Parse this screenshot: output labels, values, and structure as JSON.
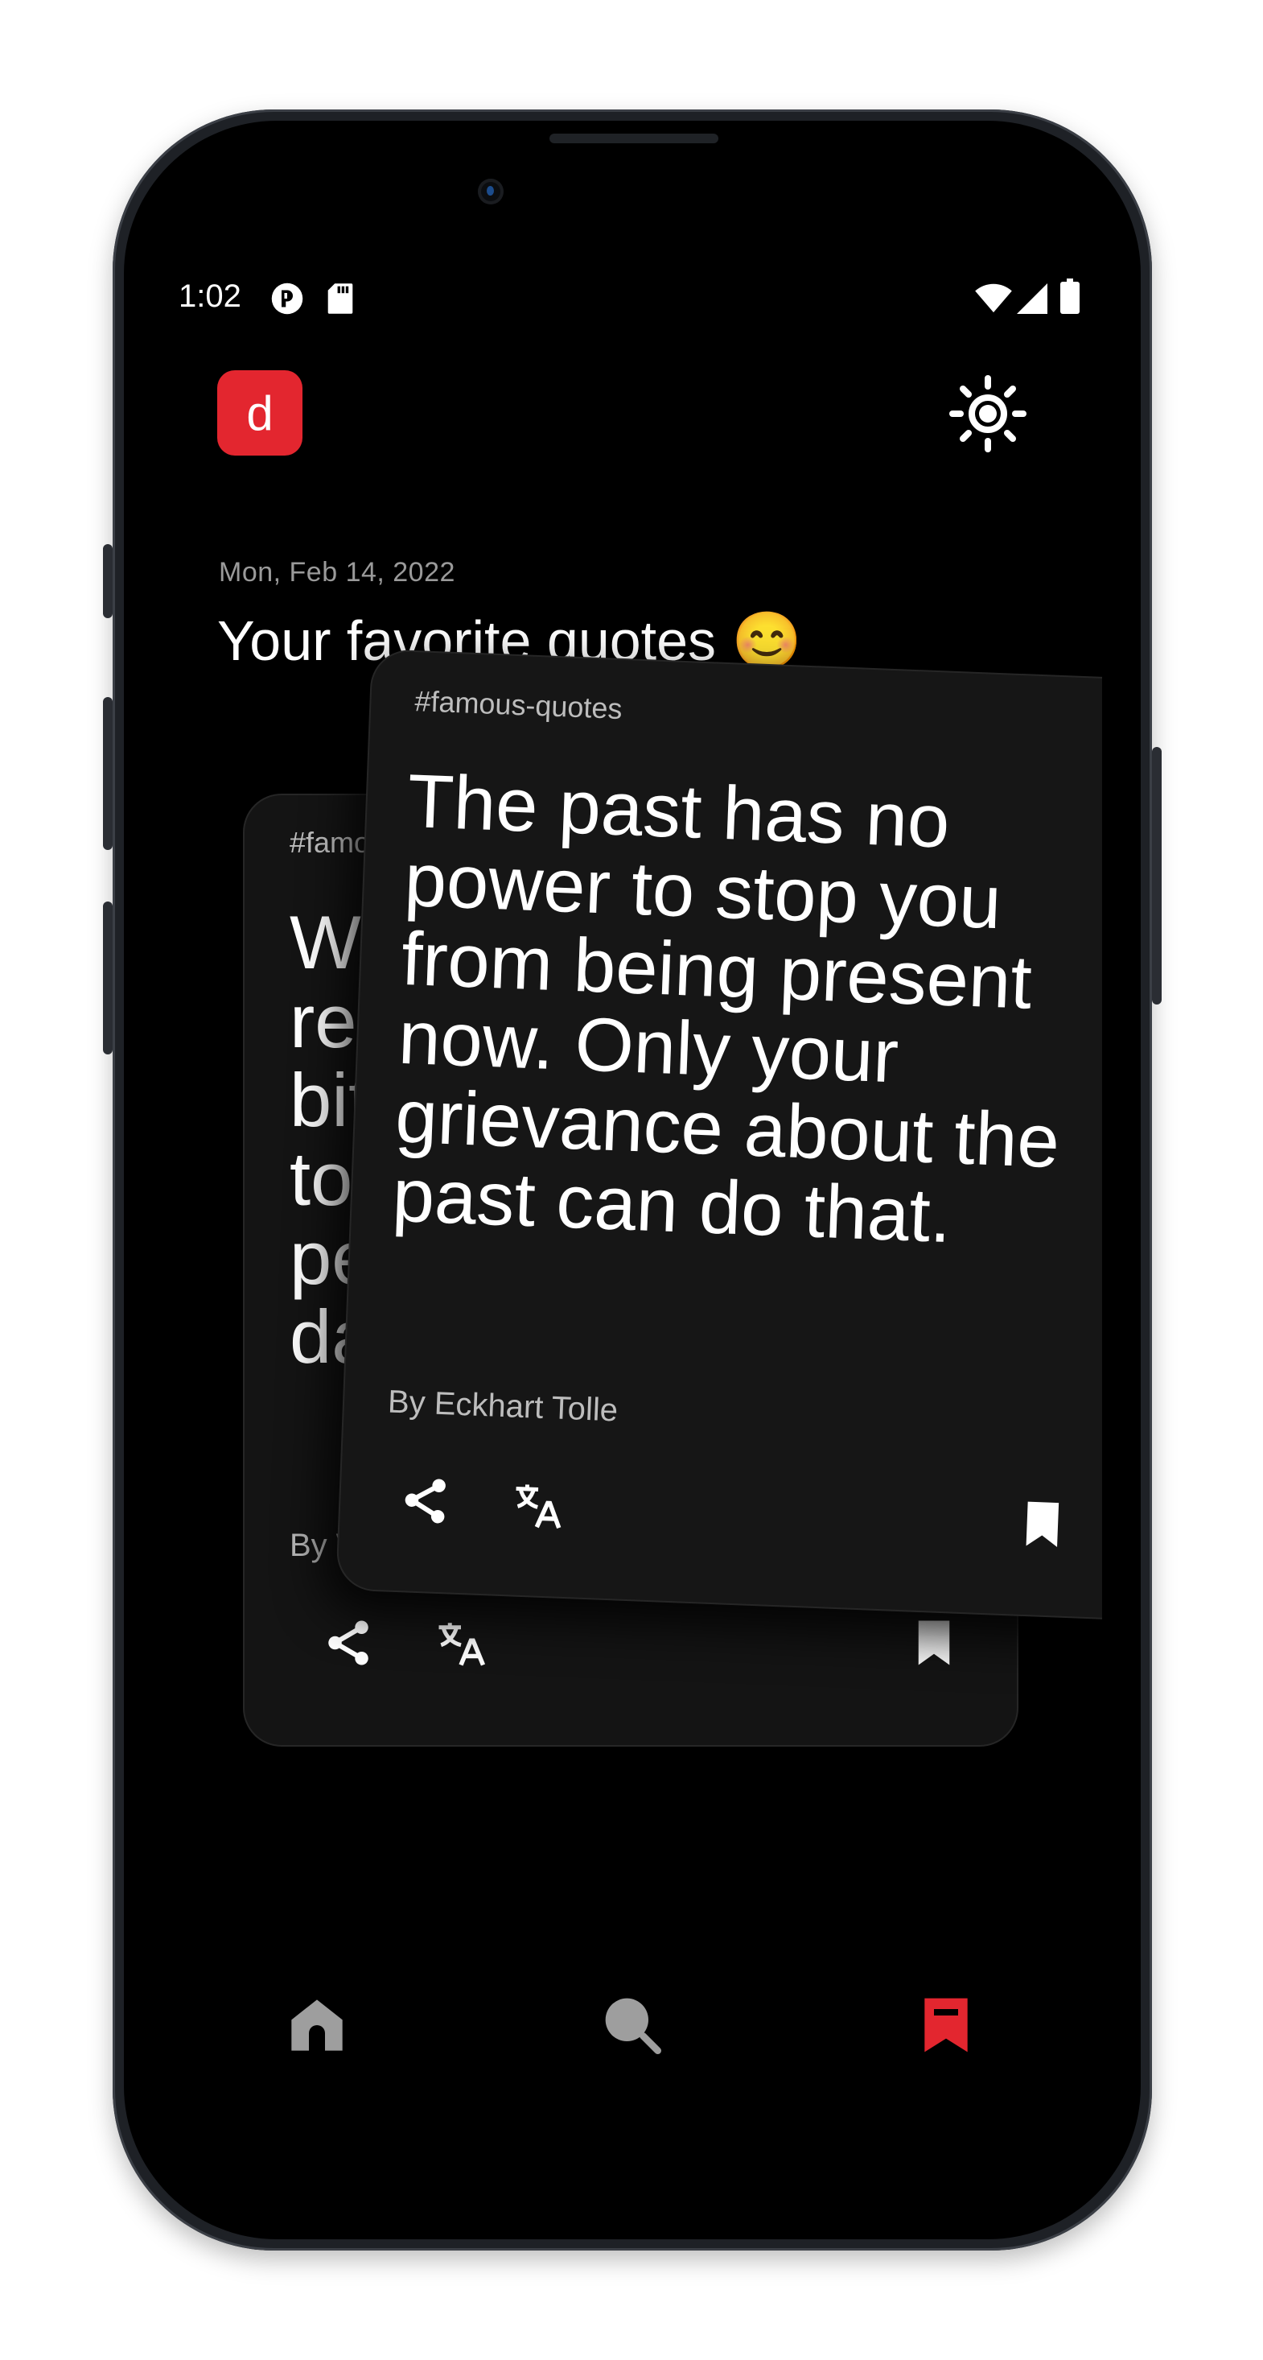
{
  "status_bar": {
    "time": "1:02",
    "icons": [
      "talkback-icon",
      "sd-card-icon",
      "wifi-icon",
      "signal-icon",
      "battery-icon"
    ]
  },
  "header": {
    "logo_letter": "d",
    "theme_toggle_icon": "sun-icon"
  },
  "main": {
    "date": "Mon, Feb 14, 2022",
    "title": "Your favorite quotes 😊"
  },
  "cards": [
    {
      "tag": "#famous-quotes",
      "quote": "We realize bitterness to to people da",
      "author": "By W",
      "actions": [
        "share-icon",
        "translate-icon",
        "bookmark-icon"
      ]
    },
    {
      "tag": "#famous-quotes",
      "quote": "The past has no power to stop you from being present now. Only your grievance about the past can do that.",
      "author": "By Eckhart Tolle",
      "actions": [
        "share-icon",
        "translate-icon",
        "bookmark-icon"
      ]
    }
  ],
  "bottom_nav": {
    "items": [
      {
        "name": "home",
        "icon": "home-icon",
        "active": false
      },
      {
        "name": "search",
        "icon": "search-icon",
        "active": false
      },
      {
        "name": "saved",
        "icon": "bookmark-icon",
        "active": true
      }
    ]
  },
  "colors": {
    "accent": "#e3262f",
    "background": "#000000",
    "card": "#141414",
    "muted_text": "#9a9a9a",
    "inactive_nav": "#9e9e9e"
  }
}
